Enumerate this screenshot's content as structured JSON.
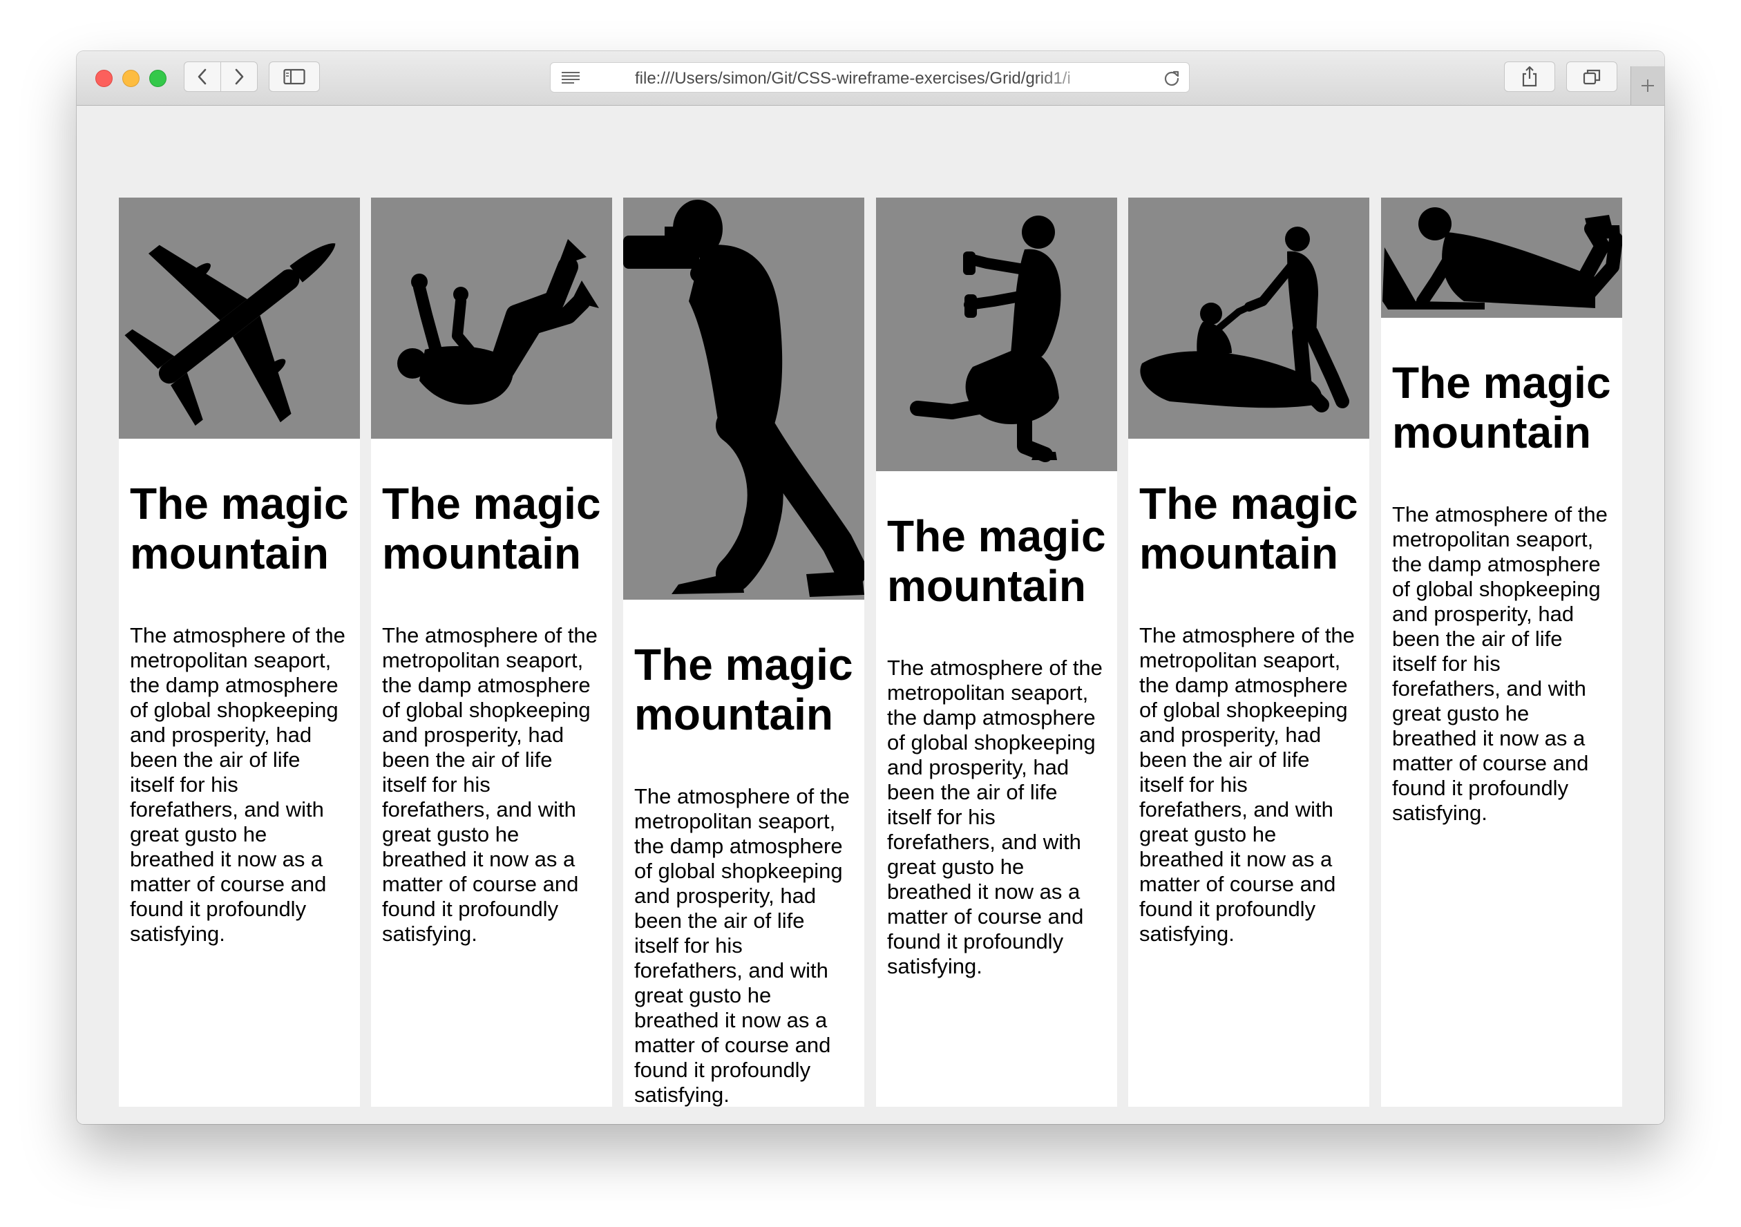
{
  "browser": {
    "url": "file:///Users/simon/Git/CSS-wireframe-exercises/Grid/grid1/i",
    "icons": [
      "back-arrow-icon",
      "forward-arrow-icon",
      "sidebar-icon",
      "reader-icon",
      "reload-icon",
      "share-icon",
      "tabs-icon",
      "plus-icon"
    ]
  },
  "cards": [
    {
      "image": "airplane-silhouette",
      "title": "The magic mountain",
      "text": "The atmosphere of the metropolitan seaport, the damp atmosphere of global shopkeeping and prosperity, had been the air of life itself for his forefathers, and with great gusto he breathed it now as a matter of course and found it profoundly satisfying."
    },
    {
      "image": "falling-man-silhouette",
      "title": "The magic mountain",
      "text": "The atmosphere of the metropolitan seaport, the damp atmosphere of global shopkeeping and prosperity, had been the air of life itself for his forefathers, and with great gusto he breathed it now as a matter of course and found it profoundly satisfying."
    },
    {
      "image": "photographer-silhouette",
      "title": "The magic mountain",
      "text": "The atmosphere of the metropolitan seaport, the damp atmosphere of global shopkeeping and prosperity, had been the air of life itself for his forefathers, and with great gusto he breathed it now as a matter of course and found it profoundly satisfying."
    },
    {
      "image": "dancer-silhouette",
      "title": "The magic mountain",
      "text": "The atmosphere of the metropolitan seaport, the damp atmosphere of global shopkeeping and prosperity, had been the air of life itself for his forefathers, and with great gusto he breathed it now as a matter of course and found it profoundly satisfying."
    },
    {
      "image": "couple-silhouette",
      "title": "The magic mountain",
      "text": "The atmosphere of the metropolitan seaport, the damp atmosphere of global shopkeeping and prosperity, had been the air of life itself for his forefathers, and with great gusto he breathed it now as a matter of course and found it profoundly satisfying."
    },
    {
      "image": "man-with-laptop-silhouette",
      "title": "The magic mountain",
      "text": "The atmosphere of the metropolitan seaport, the damp atmosphere of global shopkeeping and prosperity, had been the air of life itself for his forefathers, and with great gusto he breathed it now as a matter of course and found it profoundly satisfying."
    }
  ]
}
